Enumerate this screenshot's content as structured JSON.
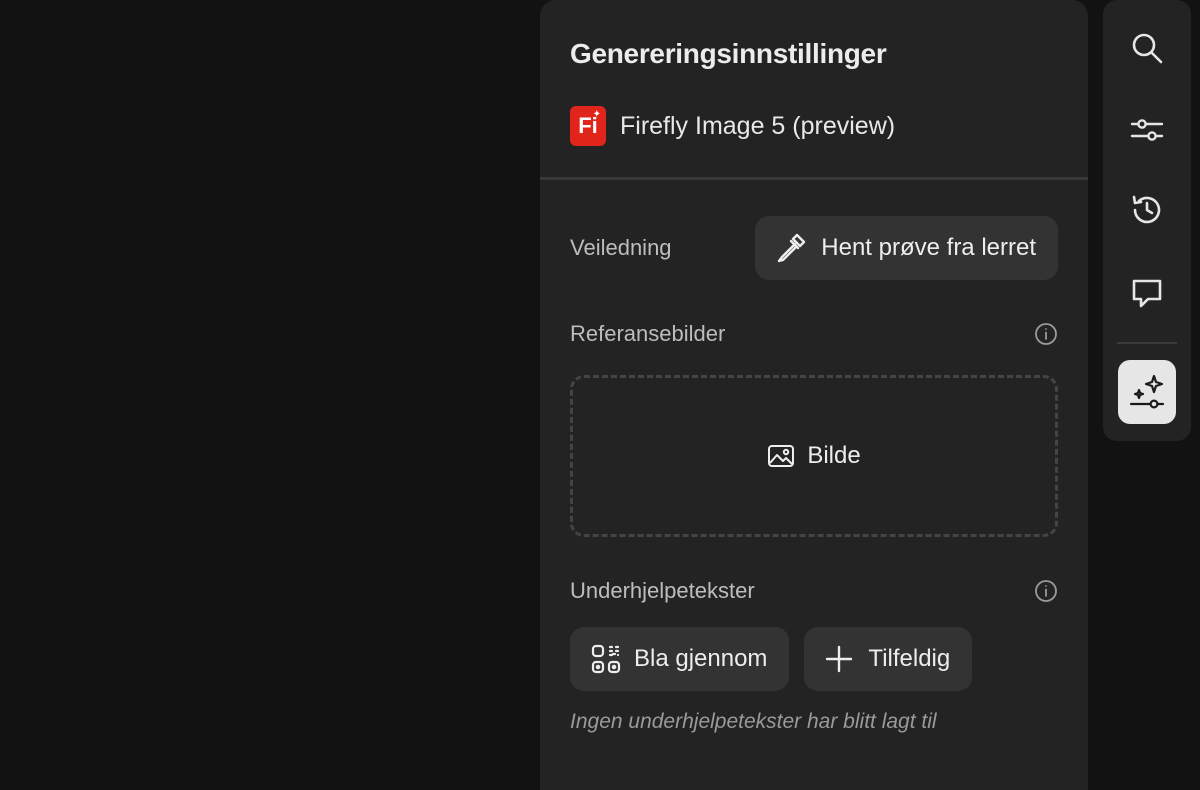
{
  "panel": {
    "title": "Genereringsinnstillinger",
    "model": {
      "logo_text": "Fi",
      "name": "Firefly Image 5 (preview)",
      "brand_color": "#e1251b"
    }
  },
  "guidance": {
    "label": "Veiledning",
    "sample_button": "Hent prøve fra lerret",
    "sample_icon": "eyedropper-icon"
  },
  "reference_images": {
    "label": "Referansebilder",
    "info_icon": "info-icon",
    "dropzone_label": "Bilde",
    "dropzone_icon": "image-icon"
  },
  "prompt_suffixes": {
    "label": "Underhjelpetekster",
    "info_icon": "info-icon",
    "browse_button": "Bla gjennom",
    "browse_icon": "browse-grid-icon",
    "random_button": "Tilfeldig",
    "random_icon": "plus-icon",
    "empty_text": "Ingen underhjelpetekster har blitt lagt til"
  },
  "rail": {
    "items": [
      {
        "icon": "search-icon"
      },
      {
        "icon": "sliders-icon"
      },
      {
        "icon": "history-icon"
      },
      {
        "icon": "comment-icon"
      },
      {
        "icon": "generation-settings-icon",
        "active": true
      }
    ]
  },
  "colors": {
    "background": "#121212",
    "panel": "#232323",
    "button": "#333333",
    "active_rail": "#e6e6e6"
  }
}
